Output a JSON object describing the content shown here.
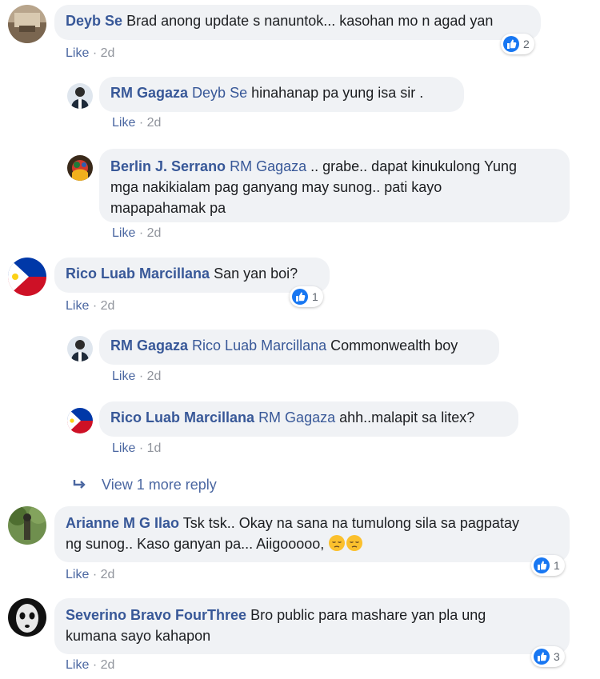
{
  "comments": [
    {
      "author": "Deyb Se",
      "text": "Brad anong update s nanuntok... kasohan mo n agad yan",
      "like": "Like",
      "time": "2d",
      "reactions": "2"
    },
    {
      "author": "RM Gagaza",
      "mention": "Deyb Se",
      "text": "hinahanap pa yung isa sir .",
      "like": "Like",
      "time": "2d"
    },
    {
      "author": "Berlin J. Serrano",
      "mention": "RM Gagaza",
      "text_line1": ".. grabe.. dapat kinukulong Yung",
      "text_line2": "mga nakikialam pag ganyang may sunog.. pati kayo",
      "text_line3": "mapapahamak pa",
      "like": "Like",
      "time": "2d"
    },
    {
      "author": "Rico Luab Marcillana",
      "text": "San yan boi?",
      "like": "Like",
      "time": "2d",
      "reactions": "1"
    },
    {
      "author": "RM Gagaza",
      "mention": "Rico Luab Marcillana",
      "text": "Commonwealth boy",
      "like": "Like",
      "time": "2d"
    },
    {
      "author": "Rico Luab Marcillana",
      "mention": "RM Gagaza",
      "text": "ahh..malapit sa litex?",
      "like": "Like",
      "time": "1d"
    },
    {
      "author": "Arianne M G Ilao",
      "text_line1": "Tsk tsk.. Okay na sana na tumulong sila sa pagpatay",
      "text_line2": "ng sunog.. Kaso ganyan pa... Aiigooooo,",
      "like": "Like",
      "time": "2d",
      "reactions": "1"
    },
    {
      "author": "Severino Bravo FourThree",
      "text_line1": "Bro public para mashare yan pla ung",
      "text_line2": "kumana sayo kahapon",
      "like": "Like",
      "time": "2d",
      "reactions": "3"
    }
  ],
  "view_more": "View 1 more reply",
  "separator": "·",
  "colors": {
    "author": "#385898",
    "bubble": "#f0f2f5",
    "like": "#4b67a1",
    "meta": "#90949c",
    "reaction": "#1877f2"
  }
}
